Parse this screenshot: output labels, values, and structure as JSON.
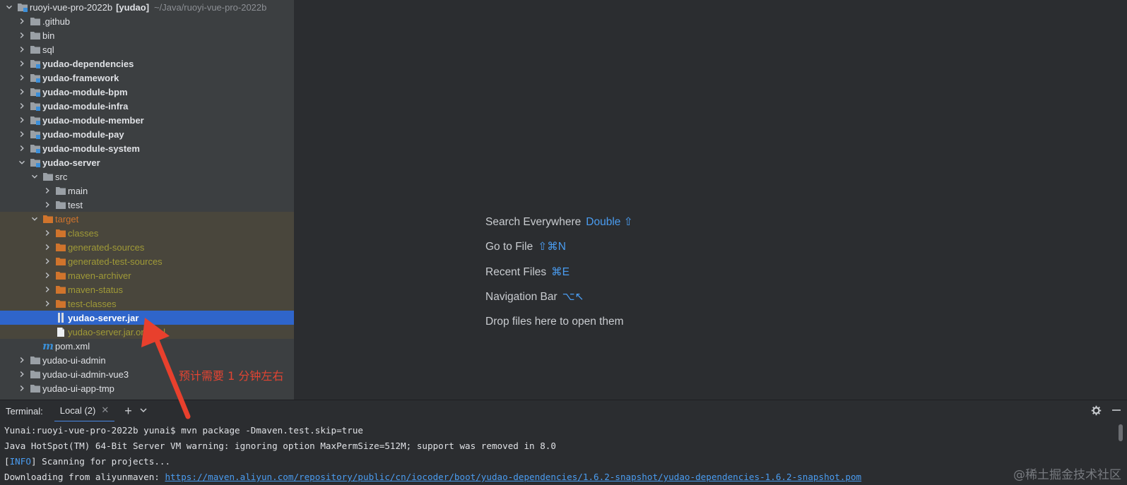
{
  "tree": {
    "root": {
      "name": "ruoyi-vue-pro-2022b",
      "module": "[yudao]",
      "path": "~/Java/ruoyi-vue-pro-2022b"
    },
    "items": [
      {
        "label": ".github",
        "expanded": false,
        "bold": false,
        "icon": "folder-icon"
      },
      {
        "label": "bin",
        "expanded": false,
        "bold": false,
        "icon": "folder-icon"
      },
      {
        "label": "sql",
        "expanded": false,
        "bold": false,
        "icon": "folder-icon"
      },
      {
        "label": "yudao-dependencies",
        "expanded": false,
        "bold": true,
        "icon": "module-folder-icon"
      },
      {
        "label": "yudao-framework",
        "expanded": false,
        "bold": true,
        "icon": "module-folder-icon"
      },
      {
        "label": "yudao-module-bpm",
        "expanded": false,
        "bold": true,
        "icon": "module-folder-icon"
      },
      {
        "label": "yudao-module-infra",
        "expanded": false,
        "bold": true,
        "icon": "module-folder-icon"
      },
      {
        "label": "yudao-module-member",
        "expanded": false,
        "bold": true,
        "icon": "module-folder-icon"
      },
      {
        "label": "yudao-module-pay",
        "expanded": false,
        "bold": true,
        "icon": "module-folder-icon"
      },
      {
        "label": "yudao-module-system",
        "expanded": false,
        "bold": true,
        "icon": "module-folder-icon"
      },
      {
        "label": "yudao-server",
        "expanded": true,
        "bold": true,
        "icon": "module-folder-icon"
      },
      {
        "label": "src",
        "expanded": true,
        "icon": "folder-icon"
      },
      {
        "label": "main",
        "expanded": false,
        "icon": "folder-icon"
      },
      {
        "label": "test",
        "expanded": false,
        "icon": "folder-icon"
      },
      {
        "label": "target",
        "expanded": true,
        "icon": "excluded-folder-icon"
      },
      {
        "label": "classes",
        "expanded": false,
        "icon": "excluded-folder-icon"
      },
      {
        "label": "generated-sources",
        "expanded": false,
        "icon": "excluded-folder-icon"
      },
      {
        "label": "generated-test-sources",
        "expanded": false,
        "icon": "excluded-folder-icon"
      },
      {
        "label": "maven-archiver",
        "expanded": false,
        "icon": "excluded-folder-icon"
      },
      {
        "label": "maven-status",
        "expanded": false,
        "icon": "excluded-folder-icon"
      },
      {
        "label": "test-classes",
        "expanded": false,
        "icon": "excluded-folder-icon"
      },
      {
        "label": "yudao-server.jar",
        "selected": true,
        "icon": "jar-icon"
      },
      {
        "label": "yudao-server.jar.original",
        "icon": "file-icon"
      },
      {
        "label": "pom.xml",
        "icon": "maven-icon"
      },
      {
        "label": "yudao-ui-admin",
        "expanded": false,
        "icon": "folder-icon"
      },
      {
        "label": "yudao-ui-admin-vue3",
        "expanded": false,
        "icon": "folder-icon"
      },
      {
        "label": "yudao-ui-app-tmp",
        "expanded": false,
        "icon": "folder-icon"
      }
    ]
  },
  "editor": {
    "hints": [
      {
        "label": "Search Everywhere",
        "key": "Double ⇧"
      },
      {
        "label": "Go to File",
        "key": "⇧⌘N"
      },
      {
        "label": "Recent Files",
        "key": "⌘E"
      },
      {
        "label": "Navigation Bar",
        "key": "⌥↖"
      },
      {
        "label": "Drop files here to open them",
        "key": ""
      }
    ]
  },
  "annotation": {
    "text": "预计需要 1 分钟左右"
  },
  "terminal": {
    "title": "Terminal:",
    "tab": "Local (2)",
    "lines": {
      "prompt": "Yunai:ruoyi-vue-pro-2022b yunai$ mvn package -Dmaven.test.skip=true",
      "warning": "Java HotSpot(TM) 64-Bit Server VM warning: ignoring option MaxPermSize=512M; support was removed in 8.0",
      "info_tag": "INFO",
      "info_text": " Scanning for projects...",
      "download_prefix": "Downloading from aliyunmaven: ",
      "download_url": "https://maven.aliyun.com/repository/public/cn/iocoder/boot/yudao-dependencies/1.6.2-snapshot/yudao-dependencies-1.6.2-snapshot.pom"
    }
  },
  "watermark": "@稀土掘金技术社区",
  "colors": {
    "tree_bg": "#3c3f41",
    "editor_bg": "#2b2d30",
    "excluded_bg": "#49463c",
    "selection": "#2f65ca",
    "accent": "#4a9cf0",
    "annotation": "#e34432"
  }
}
